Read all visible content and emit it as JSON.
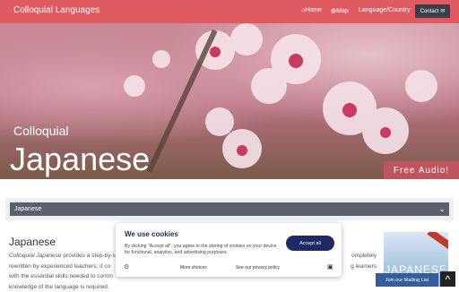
{
  "nav": {
    "brand": "Colloquial Languages",
    "home": "Home",
    "map": "Map",
    "language_country": "Language/Country",
    "contact": "Contact"
  },
  "hero": {
    "small_title": "Colloquial",
    "big_title": "Japanese",
    "free_audio": "Free Audio!"
  },
  "language_select": {
    "value": "Japanese"
  },
  "content": {
    "title": "Japanese",
    "book_title": "JAPANESE",
    "line1_italic": "Colloquial Japanese",
    "line1_rest": " provides a step-by-s",
    "line1_right": "ompletely",
    "line2_left": "rewritten by experienced teachers; it co",
    "line2_right": "g learners",
    "line3_left": "with the essential skills needed to comm",
    "line4_left": "knowledge of the language is required."
  },
  "cookie": {
    "title": "We use cookies",
    "body": "By clicking \"Accept all\", you agree to the storing of cookies on your device for functional, analytics, and advertising purposes.",
    "accept": "Accept all",
    "more_choices": "More choices",
    "privacy_policy": "See our privacy policy"
  },
  "mailing_list": "Join our Mailing List",
  "colors": {
    "navbar": "#e05a62",
    "contact_button": "#3b3f49",
    "free_audio": "#c0545c",
    "accept_button": "#1e2a63",
    "select_bar": "#5a616c"
  },
  "icons": {
    "home": "home-icon",
    "map": "globe-icon",
    "contact": "envelope-icon",
    "select": "double-chevron-down-icon",
    "scroll_top": "chevron-up-icon"
  }
}
